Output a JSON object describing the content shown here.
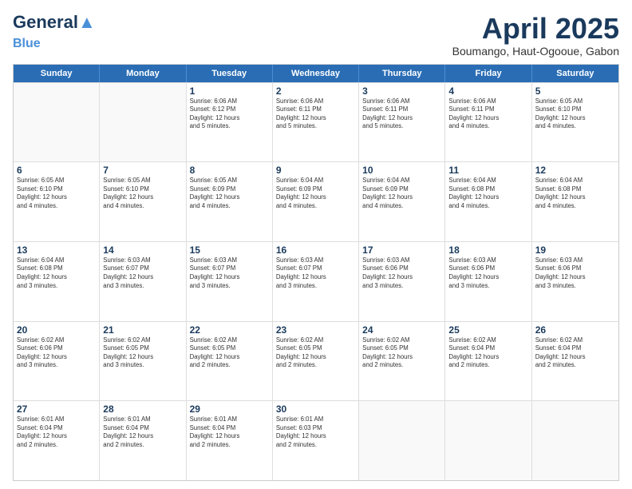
{
  "header": {
    "logo_line1": "General",
    "logo_line2": "Blue",
    "title": "April 2025",
    "location": "Boumango, Haut-Ogooue, Gabon"
  },
  "days_of_week": [
    "Sunday",
    "Monday",
    "Tuesday",
    "Wednesday",
    "Thursday",
    "Friday",
    "Saturday"
  ],
  "weeks": [
    [
      {
        "day": "",
        "info": "",
        "empty": true
      },
      {
        "day": "",
        "info": "",
        "empty": true
      },
      {
        "day": "1",
        "info": "Sunrise: 6:06 AM\nSunset: 6:12 PM\nDaylight: 12 hours\nand 5 minutes."
      },
      {
        "day": "2",
        "info": "Sunrise: 6:06 AM\nSunset: 6:11 PM\nDaylight: 12 hours\nand 5 minutes."
      },
      {
        "day": "3",
        "info": "Sunrise: 6:06 AM\nSunset: 6:11 PM\nDaylight: 12 hours\nand 5 minutes."
      },
      {
        "day": "4",
        "info": "Sunrise: 6:06 AM\nSunset: 6:11 PM\nDaylight: 12 hours\nand 4 minutes."
      },
      {
        "day": "5",
        "info": "Sunrise: 6:05 AM\nSunset: 6:10 PM\nDaylight: 12 hours\nand 4 minutes."
      }
    ],
    [
      {
        "day": "6",
        "info": "Sunrise: 6:05 AM\nSunset: 6:10 PM\nDaylight: 12 hours\nand 4 minutes."
      },
      {
        "day": "7",
        "info": "Sunrise: 6:05 AM\nSunset: 6:10 PM\nDaylight: 12 hours\nand 4 minutes."
      },
      {
        "day": "8",
        "info": "Sunrise: 6:05 AM\nSunset: 6:09 PM\nDaylight: 12 hours\nand 4 minutes."
      },
      {
        "day": "9",
        "info": "Sunrise: 6:04 AM\nSunset: 6:09 PM\nDaylight: 12 hours\nand 4 minutes."
      },
      {
        "day": "10",
        "info": "Sunrise: 6:04 AM\nSunset: 6:09 PM\nDaylight: 12 hours\nand 4 minutes."
      },
      {
        "day": "11",
        "info": "Sunrise: 6:04 AM\nSunset: 6:08 PM\nDaylight: 12 hours\nand 4 minutes."
      },
      {
        "day": "12",
        "info": "Sunrise: 6:04 AM\nSunset: 6:08 PM\nDaylight: 12 hours\nand 4 minutes."
      }
    ],
    [
      {
        "day": "13",
        "info": "Sunrise: 6:04 AM\nSunset: 6:08 PM\nDaylight: 12 hours\nand 3 minutes."
      },
      {
        "day": "14",
        "info": "Sunrise: 6:03 AM\nSunset: 6:07 PM\nDaylight: 12 hours\nand 3 minutes."
      },
      {
        "day": "15",
        "info": "Sunrise: 6:03 AM\nSunset: 6:07 PM\nDaylight: 12 hours\nand 3 minutes."
      },
      {
        "day": "16",
        "info": "Sunrise: 6:03 AM\nSunset: 6:07 PM\nDaylight: 12 hours\nand 3 minutes."
      },
      {
        "day": "17",
        "info": "Sunrise: 6:03 AM\nSunset: 6:06 PM\nDaylight: 12 hours\nand 3 minutes."
      },
      {
        "day": "18",
        "info": "Sunrise: 6:03 AM\nSunset: 6:06 PM\nDaylight: 12 hours\nand 3 minutes."
      },
      {
        "day": "19",
        "info": "Sunrise: 6:03 AM\nSunset: 6:06 PM\nDaylight: 12 hours\nand 3 minutes."
      }
    ],
    [
      {
        "day": "20",
        "info": "Sunrise: 6:02 AM\nSunset: 6:06 PM\nDaylight: 12 hours\nand 3 minutes."
      },
      {
        "day": "21",
        "info": "Sunrise: 6:02 AM\nSunset: 6:05 PM\nDaylight: 12 hours\nand 3 minutes."
      },
      {
        "day": "22",
        "info": "Sunrise: 6:02 AM\nSunset: 6:05 PM\nDaylight: 12 hours\nand 2 minutes."
      },
      {
        "day": "23",
        "info": "Sunrise: 6:02 AM\nSunset: 6:05 PM\nDaylight: 12 hours\nand 2 minutes."
      },
      {
        "day": "24",
        "info": "Sunrise: 6:02 AM\nSunset: 6:05 PM\nDaylight: 12 hours\nand 2 minutes."
      },
      {
        "day": "25",
        "info": "Sunrise: 6:02 AM\nSunset: 6:04 PM\nDaylight: 12 hours\nand 2 minutes."
      },
      {
        "day": "26",
        "info": "Sunrise: 6:02 AM\nSunset: 6:04 PM\nDaylight: 12 hours\nand 2 minutes."
      }
    ],
    [
      {
        "day": "27",
        "info": "Sunrise: 6:01 AM\nSunset: 6:04 PM\nDaylight: 12 hours\nand 2 minutes."
      },
      {
        "day": "28",
        "info": "Sunrise: 6:01 AM\nSunset: 6:04 PM\nDaylight: 12 hours\nand 2 minutes."
      },
      {
        "day": "29",
        "info": "Sunrise: 6:01 AM\nSunset: 6:04 PM\nDaylight: 12 hours\nand 2 minutes."
      },
      {
        "day": "30",
        "info": "Sunrise: 6:01 AM\nSunset: 6:03 PM\nDaylight: 12 hours\nand 2 minutes."
      },
      {
        "day": "",
        "info": "",
        "empty": true
      },
      {
        "day": "",
        "info": "",
        "empty": true
      },
      {
        "day": "",
        "info": "",
        "empty": true
      }
    ]
  ]
}
